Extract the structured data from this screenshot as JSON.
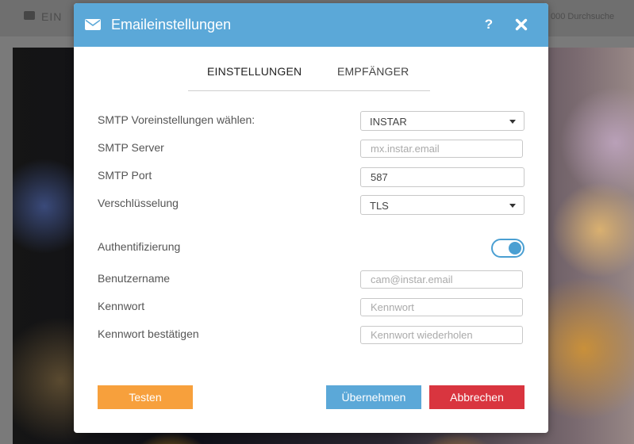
{
  "background": {
    "title_left": "EIN",
    "title_right": "000 Durchsuche"
  },
  "dialog": {
    "title": "Emaileinstellungen",
    "help_icon": "?",
    "icons": {
      "title": "envelope-icon",
      "help": "question-icon",
      "close": "close-icon"
    },
    "header_color": "#5ba8d8"
  },
  "tabs": [
    {
      "label": "EINSTELLUNGEN",
      "active": true
    },
    {
      "label": "EMPFÄNGER",
      "active": false
    }
  ],
  "form": {
    "smtp_preset": {
      "label": "SMTP Voreinstellungen wählen:",
      "value": "INSTAR"
    },
    "smtp_server": {
      "label": "SMTP Server",
      "placeholder": "mx.instar.email",
      "value": ""
    },
    "smtp_port": {
      "label": "SMTP Port",
      "value": "587"
    },
    "encryption": {
      "label": "Verschlüsselung",
      "value": "TLS"
    },
    "authentication": {
      "label": "Authentifizierung",
      "enabled": true
    },
    "username": {
      "label": "Benutzername",
      "placeholder": "cam@instar.email"
    },
    "password": {
      "label": "Kennwort",
      "placeholder": "Kennwort"
    },
    "password_confirm": {
      "label": "Kennwort bestätigen",
      "placeholder": "Kennwort wiederholen"
    }
  },
  "buttons": {
    "test": "Testen",
    "apply": "Übernehmen",
    "cancel": "Abbrechen"
  },
  "colors": {
    "accent": "#5ba8d8",
    "test": "#f7a03c",
    "cancel": "#d9353f"
  }
}
